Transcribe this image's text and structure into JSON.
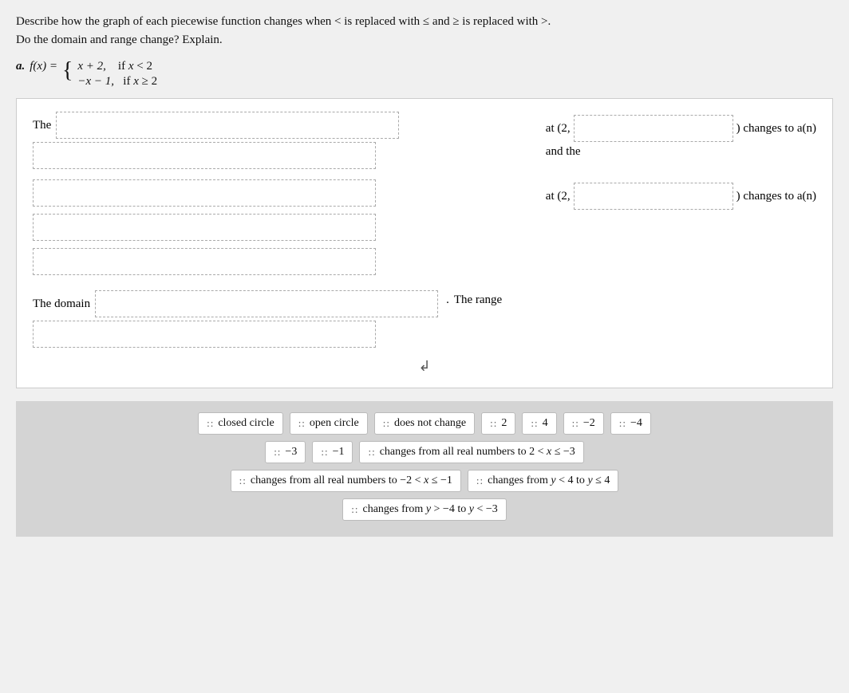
{
  "instructions": {
    "line1": "Describe how the graph of each piecewise function changes when < is replaced with ≤ and ≥ is replaced with >.",
    "line2": "Do the domain and range change? Explain."
  },
  "problem": {
    "label": "a.",
    "function_name": "f(x) =",
    "piece1_expr": "x + 2,",
    "piece1_cond": "if x < 2",
    "piece2_expr": "−x − 1,",
    "piece2_cond": "if x ≥ 2"
  },
  "fill_labels": {
    "the": "The",
    "at_2": "at (2,",
    "changes_to_an": ") changes to a(n)",
    "and_the": "and the",
    "at_2b": "at (2,",
    "changes_to_an2": ") changes to a(n)",
    "domain": "The domain",
    "range": "The range"
  },
  "drag_chips": {
    "row1": [
      {
        "label": "closed circle",
        "id": "closed-circle"
      },
      {
        "label": "open circle",
        "id": "open-circle"
      },
      {
        "label": "does not change",
        "id": "does-not-change"
      },
      {
        "label": "2",
        "id": "two"
      },
      {
        "label": "4",
        "id": "four"
      },
      {
        "label": "−2",
        "id": "neg-two"
      },
      {
        "label": "−4",
        "id": "neg-four"
      }
    ],
    "row2": [
      {
        "label": "−3",
        "id": "neg-three"
      },
      {
        "label": "−1",
        "id": "neg-one"
      },
      {
        "label": "changes from all real numbers to 2 < x ≤ −3",
        "id": "changes-allreal-2"
      }
    ],
    "row3": [
      {
        "label": "changes from all real numbers to −2 < x ≤ −1",
        "id": "changes-allreal-neg2"
      },
      {
        "label": "changes from y < 4 to y ≤ 4",
        "id": "changes-y4"
      }
    ],
    "row4": [
      {
        "label": "changes from y > −4 to y < −3",
        "id": "changes-y-neg4"
      }
    ]
  }
}
